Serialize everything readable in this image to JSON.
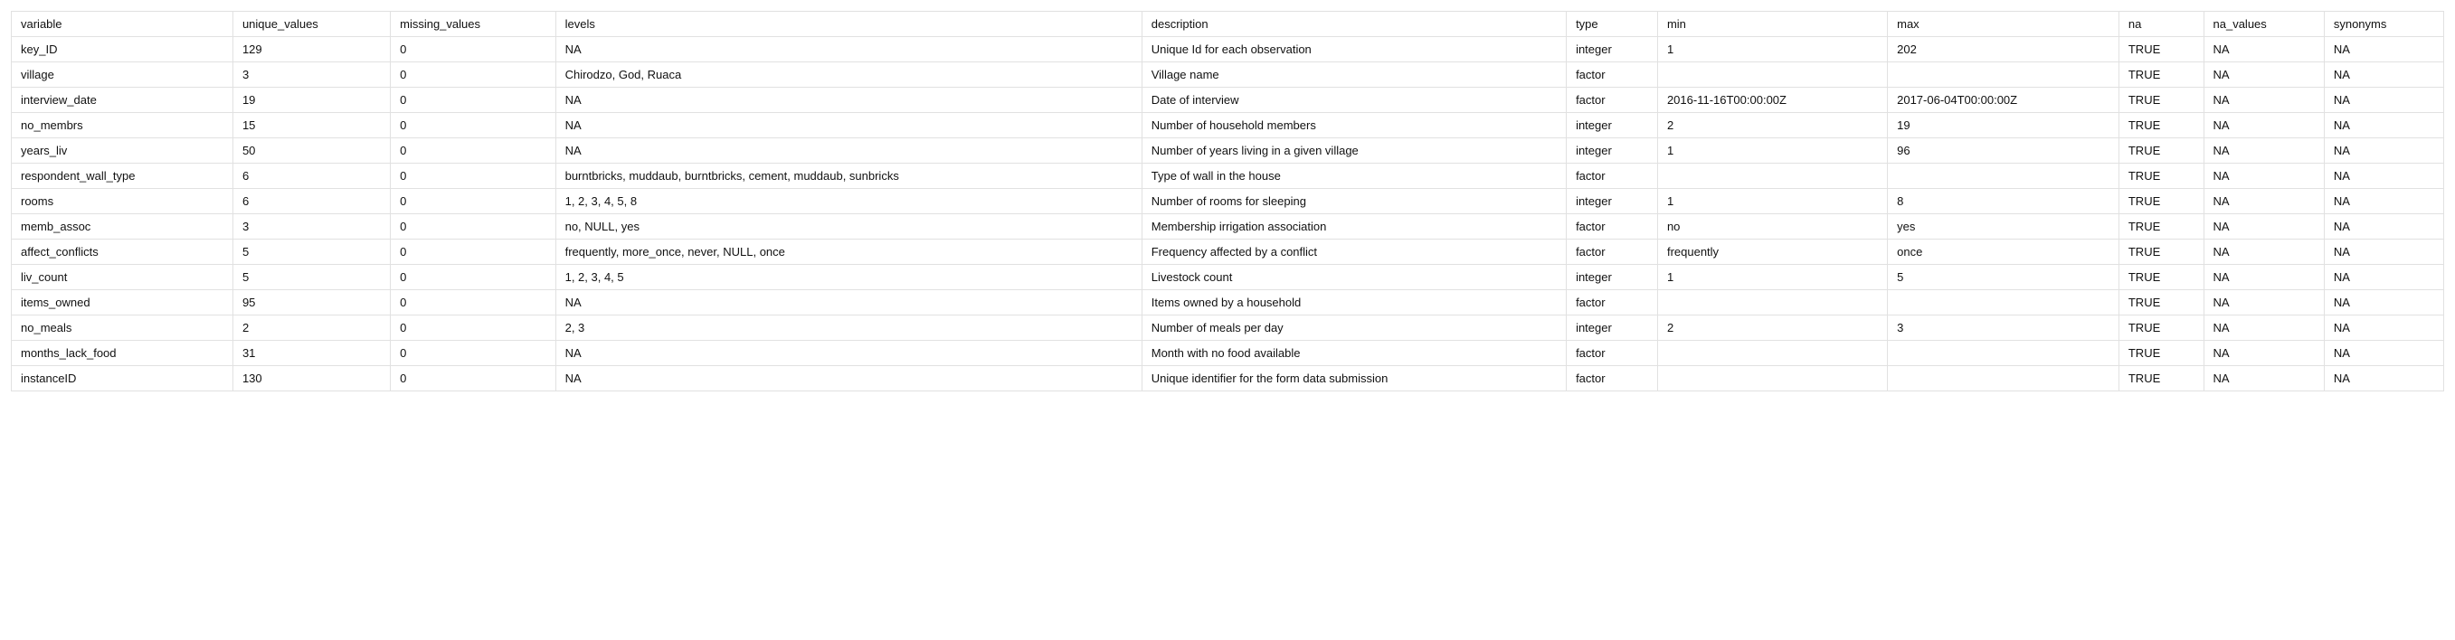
{
  "table": {
    "headers": [
      "variable",
      "unique_values",
      "missing_values",
      "levels",
      "description",
      "type",
      "min",
      "max",
      "na",
      "na_values",
      "synonyms"
    ],
    "rows": [
      {
        "variable": "key_ID",
        "unique_values": "129",
        "missing_values": "0",
        "levels": "NA",
        "description": "Unique Id for each observation",
        "type": "integer",
        "min": "1",
        "max": "202",
        "na": "TRUE",
        "na_values": "NA",
        "synonyms": "NA"
      },
      {
        "variable": "village",
        "unique_values": "3",
        "missing_values": "0",
        "levels": "Chirodzo, God, Ruaca",
        "description": "Village name",
        "type": "factor",
        "min": "",
        "max": "",
        "na": "TRUE",
        "na_values": "NA",
        "synonyms": "NA"
      },
      {
        "variable": "interview_date",
        "unique_values": "19",
        "missing_values": "0",
        "levels": "NA",
        "description": "Date of interview",
        "type": "factor",
        "min": "2016-11-16T00:00:00Z",
        "max": "2017-06-04T00:00:00Z",
        "na": "TRUE",
        "na_values": "NA",
        "synonyms": "NA"
      },
      {
        "variable": "no_membrs",
        "unique_values": "15",
        "missing_values": "0",
        "levels": "NA",
        "description": "Number of household members",
        "type": "integer",
        "min": "2",
        "max": "19",
        "na": "TRUE",
        "na_values": "NA",
        "synonyms": "NA"
      },
      {
        "variable": "years_liv",
        "unique_values": "50",
        "missing_values": "0",
        "levels": "NA",
        "description": "Number of years living in a given village",
        "type": "integer",
        "min": "1",
        "max": "96",
        "na": "TRUE",
        "na_values": "NA",
        "synonyms": "NA"
      },
      {
        "variable": "respondent_wall_type",
        "unique_values": "6",
        "missing_values": "0",
        "levels": "burntbricks,  muddaub, burntbricks, cement, muddaub, sunbricks",
        "description": "Type of wall in the house",
        "type": "factor",
        "min": "",
        "max": "",
        "na": "TRUE",
        "na_values": "NA",
        "synonyms": "NA"
      },
      {
        "variable": "rooms",
        "unique_values": "6",
        "missing_values": "0",
        "levels": "1, 2, 3, 4, 5, 8",
        "description": "Number of rooms for sleeping",
        "type": "integer",
        "min": "1",
        "max": "8",
        "na": "TRUE",
        "na_values": "NA",
        "synonyms": "NA"
      },
      {
        "variable": "memb_assoc",
        "unique_values": "3",
        "missing_values": "0",
        "levels": "no, NULL, yes",
        "description": "Membership irrigation association",
        "type": "factor",
        "min": "no",
        "max": "yes",
        "na": "TRUE",
        "na_values": "NA",
        "synonyms": "NA"
      },
      {
        "variable": "affect_conflicts",
        "unique_values": "5",
        "missing_values": "0",
        "levels": "frequently, more_once, never, NULL, once",
        "description": "Frequency affected by a conflict",
        "type": "factor",
        "min": "frequently",
        "max": "once",
        "na": "TRUE",
        "na_values": "NA",
        "synonyms": "NA"
      },
      {
        "variable": "liv_count",
        "unique_values": "5",
        "missing_values": "0",
        "levels": "1, 2, 3, 4, 5",
        "description": "Livestock count",
        "type": "integer",
        "min": "1",
        "max": "5",
        "na": "TRUE",
        "na_values": "NA",
        "synonyms": "NA"
      },
      {
        "variable": "items_owned",
        "unique_values": "95",
        "missing_values": "0",
        "levels": "NA",
        "description": "Items owned by a household",
        "type": "factor",
        "min": "",
        "max": "",
        "na": "TRUE",
        "na_values": "NA",
        "synonyms": "NA"
      },
      {
        "variable": "no_meals",
        "unique_values": "2",
        "missing_values": "0",
        "levels": "2, 3",
        "description": "Number of meals per day",
        "type": "integer",
        "min": "2",
        "max": "3",
        "na": "TRUE",
        "na_values": "NA",
        "synonyms": "NA"
      },
      {
        "variable": "months_lack_food",
        "unique_values": "31",
        "missing_values": "0",
        "levels": "NA",
        "description": "Month with no food available",
        "type": "factor",
        "min": "",
        "max": "",
        "na": "TRUE",
        "na_values": "NA",
        "synonyms": "NA"
      },
      {
        "variable": "instanceID",
        "unique_values": "130",
        "missing_values": "0",
        "levels": "NA",
        "description": "Unique identifier for the form data submission",
        "type": "factor",
        "min": "",
        "max": "",
        "na": "TRUE",
        "na_values": "NA",
        "synonyms": "NA"
      }
    ]
  }
}
